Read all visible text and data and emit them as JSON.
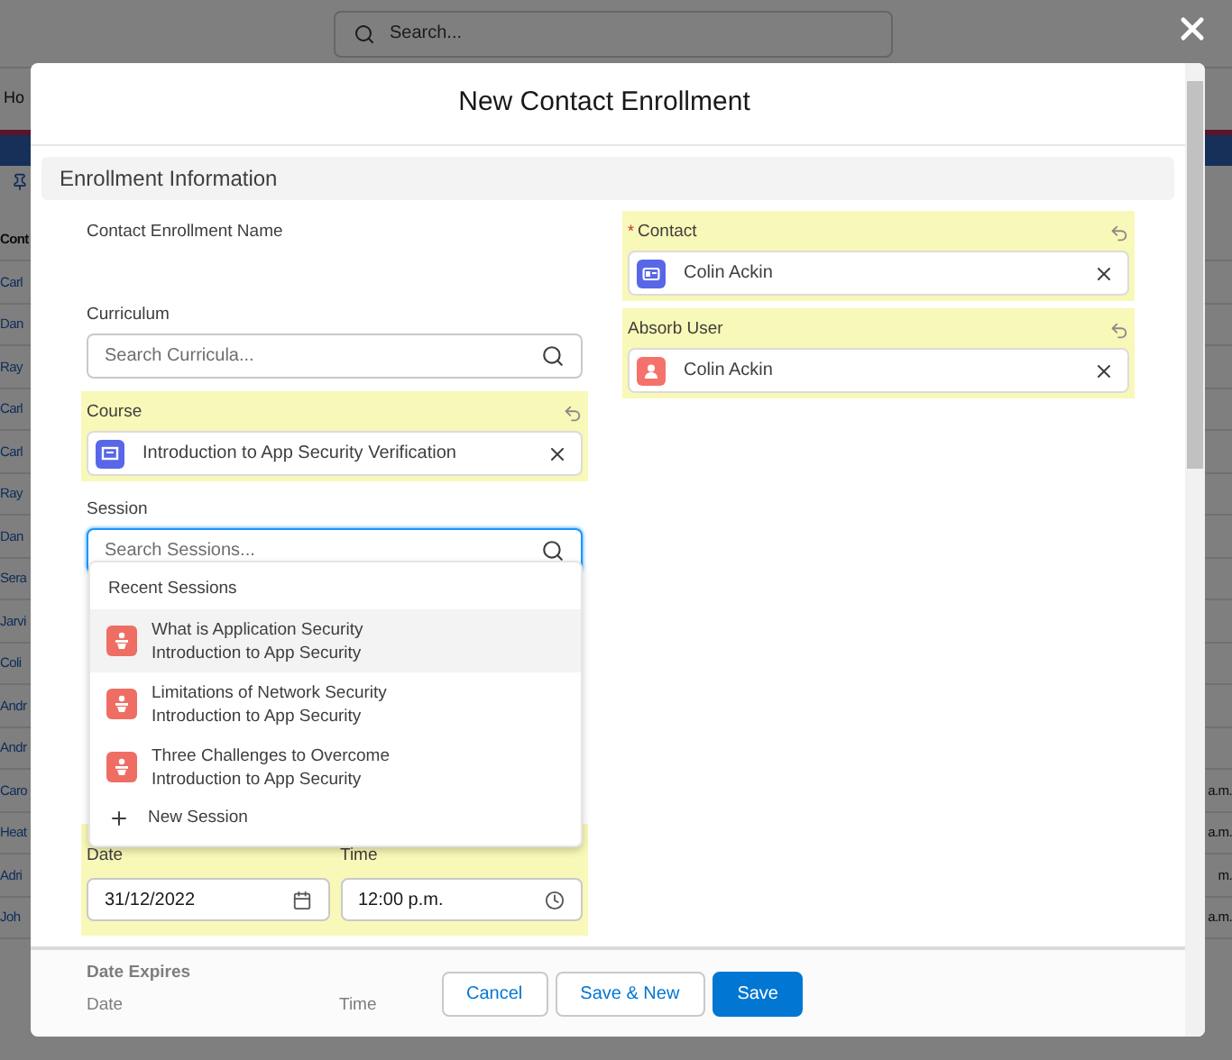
{
  "background": {
    "search_placeholder": "Search...",
    "nav_tab": "Ho",
    "column_header": "Cont",
    "rows": [
      {
        "name": "Carl"
      },
      {
        "name": "Dan"
      },
      {
        "name": "Ray"
      },
      {
        "name": "Carl"
      },
      {
        "name": "Carl"
      },
      {
        "name": "Ray"
      },
      {
        "name": "Dan"
      },
      {
        "name": "Sera"
      },
      {
        "name": "Jarvi"
      },
      {
        "name": "Coli"
      },
      {
        "name": "Andr"
      },
      {
        "name": "Andr"
      },
      {
        "name": "Caro",
        "time": "a.m."
      },
      {
        "name": "Heat",
        "time": "a.m."
      },
      {
        "name": "Adri",
        "time": "m."
      },
      {
        "name": "Joh",
        "time": "a.m."
      }
    ]
  },
  "modal": {
    "title": "New Contact Enrollment",
    "section": "Enrollment Information",
    "left_fields": [
      {
        "kind": "label_only",
        "label": "Contact Enrollment Name",
        "highlighted": false
      },
      {
        "kind": "search",
        "label": "Curriculum",
        "placeholder": "Search Curricula...",
        "highlighted": false,
        "focused": false
      },
      {
        "kind": "course",
        "label": "Course",
        "value": "Introduction to App Security Verification",
        "highlighted": true
      },
      {
        "kind": "search",
        "label": "Session",
        "placeholder": "Search Sessions...",
        "highlighted": false,
        "focused": true
      }
    ],
    "right_fields": [
      {
        "kind": "contact",
        "marker": "*",
        "label": "Contact",
        "value": "Colin Ackin",
        "highlighted": true
      },
      {
        "kind": "user",
        "label": "Absorb User",
        "value": "Colin Ackin",
        "highlighted": true
      }
    ],
    "dropdown": {
      "header": "Recent Sessions",
      "items": [
        {
          "title": "What is Application Security",
          "subtitle": "Introduction to App Security",
          "selected": true
        },
        {
          "title": "Limitations of Network Security",
          "subtitle": "Introduction to App Security",
          "selected": false
        },
        {
          "title": "Three Challenges to Overcome",
          "subtitle": "Introduction to App Security",
          "selected": false
        }
      ],
      "action": "New Session"
    },
    "start": {
      "highlighted": true,
      "date_label": "Date",
      "date": "31/12/2022",
      "time_label": "Time",
      "time": "12:00 p.m."
    },
    "expires": {
      "title": "Date Expires",
      "date_label": "Date",
      "time_label": "Time"
    },
    "buttons": [
      {
        "label": "Cancel",
        "kind": "neutral"
      },
      {
        "label": "Save & New",
        "kind": "neutral"
      },
      {
        "label": "Save",
        "kind": "brand"
      }
    ]
  }
}
